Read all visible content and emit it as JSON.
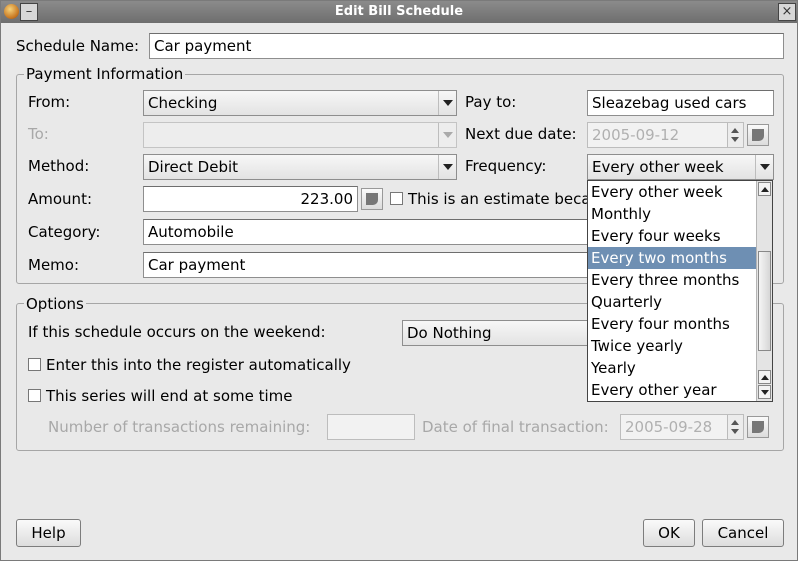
{
  "window": {
    "title": "Edit Bill Schedule",
    "left_button": "–",
    "right_button": "×"
  },
  "schedule_name": {
    "label": "Schedule Name:",
    "value": "Car payment"
  },
  "payment_info": {
    "section_title": "Payment Information",
    "from_label": "From:",
    "from_value": "Checking",
    "to_label": "To:",
    "to_value": "",
    "method_label": "Method:",
    "method_value": "Direct Debit",
    "amount_label": "Amount:",
    "amount_value": "223.00",
    "estimate_label": "This is an estimate beca",
    "category_label": "Category:",
    "category_value": "Automobile",
    "memo_label": "Memo:",
    "memo_value": "Car payment",
    "pay_to_label": "Pay to:",
    "pay_to_value": "Sleazebag used cars",
    "next_due_label": "Next due date:",
    "next_due_value": "2005-09-12",
    "frequency_label": "Frequency:",
    "frequency_value": "Every other week"
  },
  "frequency_dropdown": {
    "options": [
      "Every other week",
      "Monthly",
      "Every four weeks",
      "Every two months",
      "Every three months",
      "Quarterly",
      "Every four months",
      "Twice yearly",
      "Yearly",
      "Every other year"
    ],
    "highlighted": "Every two months"
  },
  "options": {
    "section_title": "Options",
    "weekend_label": "If this schedule occurs on the weekend:",
    "weekend_value": "Do Nothing",
    "auto_enter_label": "Enter this into the register automatically",
    "auto_enter_checked": false,
    "series_end_label": "This series will end at some time",
    "series_end_checked": false,
    "remaining_label": "Number of transactions remaining:",
    "remaining_value": "",
    "final_date_label": "Date of final transaction:",
    "final_date_value": "2005-09-28"
  },
  "buttons": {
    "help": "Help",
    "ok": "OK",
    "cancel": "Cancel"
  },
  "colors": {
    "selection": "#6e8fb3",
    "titlebar": "#7a7a7a",
    "background": "#e9e9e9"
  }
}
